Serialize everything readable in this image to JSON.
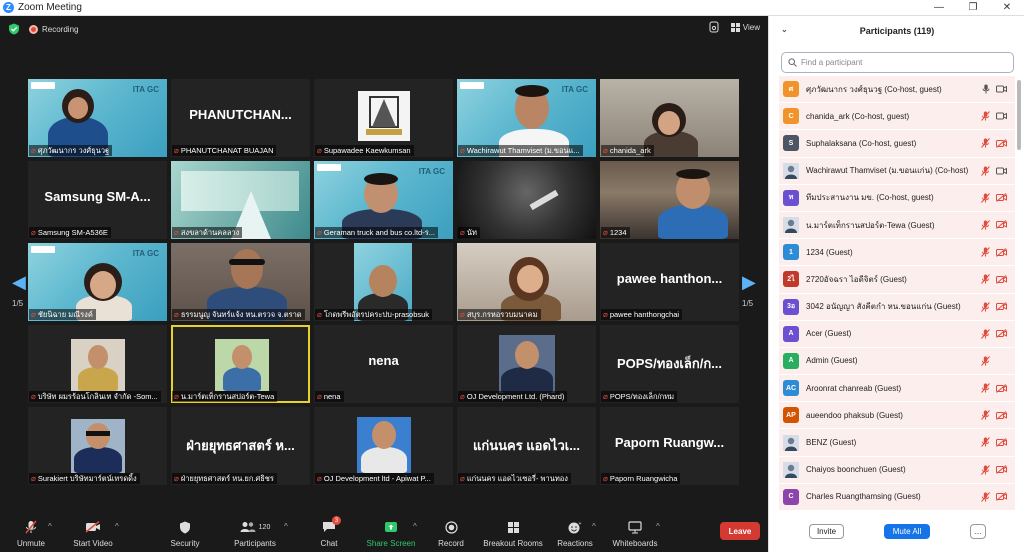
{
  "window": {
    "title": "Zoom Meeting",
    "minimize": "—",
    "maximize": "❐",
    "close": "✕"
  },
  "meeting": {
    "recording_label": "Recording",
    "view_label": "View",
    "page_left": "1/5",
    "page_right": "1/5",
    "tiles": [
      {
        "name": "ศุภวัฒนากร วงศ์ธุนวฐ",
        "big": "",
        "kind": "banner"
      },
      {
        "name": "PHANUTCHANAT BUAJAN",
        "big": "PHANUTCHAN...",
        "kind": "text"
      },
      {
        "name": "Supawadee Kaewkumsan",
        "big": "",
        "kind": "logo"
      },
      {
        "name": "Wachirawut Thamviset (ม.ขอนแ...",
        "big": "",
        "kind": "banner"
      },
      {
        "name": "chanida_ark",
        "big": "",
        "kind": "room"
      },
      {
        "name": "Samsung SM-A536E",
        "big": "Samsung SM-A...",
        "kind": "text"
      },
      {
        "name": "สงขลาด้านคลลาง",
        "big": "",
        "kind": "city"
      },
      {
        "name": "Geraman truck and bus co.ltd-ร...",
        "big": "",
        "kind": "banner"
      },
      {
        "name": "นัท",
        "big": "",
        "kind": "dark"
      },
      {
        "name": "1234",
        "big": "",
        "kind": "room"
      },
      {
        "name": "ชัยนิฉาย มณีรงค์",
        "big": "",
        "kind": "banner"
      },
      {
        "name": "ธรรมนูญ จันทร์แจ้ง หน.ตรวจ จ.ตราด",
        "big": "",
        "kind": "room"
      },
      {
        "name": "โกดพรีพอัตรปคระปบ-prasobsuk",
        "big": "",
        "kind": "banner"
      },
      {
        "name": "สบุร.กรหอรวบมนาคม",
        "big": "",
        "kind": "room"
      },
      {
        "name": "pawee hanthongchai",
        "big": "pawee hanthon...",
        "kind": "text"
      },
      {
        "name": "บริษัท ผมรร้อนโกลินเท จำกัด -Som...",
        "big": "",
        "kind": "photo"
      },
      {
        "name": "น.มาร์ตเท็กรานสปอร์ต-Tewa",
        "big": "",
        "kind": "photo"
      },
      {
        "name": "nena",
        "big": "nena",
        "kind": "text"
      },
      {
        "name": "OJ Development Ltd. (Phard)",
        "big": "",
        "kind": "photo"
      },
      {
        "name": "POPS/ทองเล็ก/กทม",
        "big": "POPS/ทองเล็ก/ก...",
        "kind": "text"
      },
      {
        "name": "Surakiert บริษัทมาร์ตน์เทรดดิ้ง",
        "big": "",
        "kind": "photo"
      },
      {
        "name": "ฝ่ายยุทธศาสตร์ หน.ยก.ศธิชร",
        "big": "ฝ่ายยุทธศาสตร์ ห...",
        "kind": "text"
      },
      {
        "name": "OJ Development ltd - Apiwat P...",
        "big": "",
        "kind": "photo"
      },
      {
        "name": "แก่นนคร แอดไวเซอรี่- พานทอง",
        "big": "แก่นนคร แอดไวเ...",
        "kind": "text"
      },
      {
        "name": "Paporn Ruangwicha",
        "big": "Paporn Ruangw...",
        "kind": "text"
      }
    ]
  },
  "toolbar": {
    "unmute": "Unmute",
    "start_video": "Start Video",
    "security": "Security",
    "participants": "Participants",
    "participants_count": "120",
    "chat": "Chat",
    "chat_badge": "3",
    "share_screen": "Share Screen",
    "record": "Record",
    "breakout": "Breakout Rooms",
    "reactions": "Reactions",
    "whiteboards": "Whiteboards",
    "leave": "Leave"
  },
  "panel": {
    "title": "Participants (119)",
    "search_placeholder": "Find a participant",
    "invite": "Invite",
    "mute_all": "Mute All",
    "more": "...",
    "participants": [
      {
        "initial": "ศ",
        "color": "#f0932b",
        "name": "ศุภวัฒนากร วงศ์ธุนวฐ (Co-host, guest)",
        "mic": "on",
        "cam": "on"
      },
      {
        "initial": "C",
        "color": "#f0932b",
        "name": "chanida_ark (Co-host, guest)",
        "mic": "off",
        "cam": "on"
      },
      {
        "initial": "S",
        "color": "#4b5563",
        "name": "Suphalaksana (Co-host, guest)",
        "mic": "off",
        "cam": "off"
      },
      {
        "initial": "",
        "color": "#9aa0a6",
        "name": "Wachirawut Thamviset (ม.ขอนแก่น) (Co-host)",
        "mic": "off",
        "cam": "on"
      },
      {
        "initial": "ท",
        "color": "#6b4fd1",
        "name": "ทีมประสานงาน มข. (Co-host, guest)",
        "mic": "off",
        "cam": "off"
      },
      {
        "initial": "",
        "color": "#9aa0a6",
        "name": "น.มาร์ตเท็กรานสปอร์ต-Tewa (Guest)",
        "mic": "off",
        "cam": "off"
      },
      {
        "initial": "1",
        "color": "#2d8cd6",
        "name": "1234 (Guest)",
        "mic": "off",
        "cam": "off"
      },
      {
        "initial": "2ไ",
        "color": "#c0392b",
        "name": "2720อัจฉรา ไอดีจิตร์ (Guest)",
        "mic": "off",
        "cam": "off"
      },
      {
        "initial": "3อ",
        "color": "#6b4fd1",
        "name": "3042 อนัญญา สังคีตกำ หน.ขอนแก่น (Guest)",
        "mic": "off",
        "cam": "off"
      },
      {
        "initial": "A",
        "color": "#6b4fd1",
        "name": "Acer (Guest)",
        "mic": "off",
        "cam": "off"
      },
      {
        "initial": "A",
        "color": "#27ae60",
        "name": "Admin (Guest)",
        "mic": "off",
        "cam": ""
      },
      {
        "initial": "AC",
        "color": "#2d8cd6",
        "name": "Aroonrat chanreab (Guest)",
        "mic": "off",
        "cam": "off"
      },
      {
        "initial": "AP",
        "color": "#d35400",
        "name": "aueendoo phaksub (Guest)",
        "mic": "off",
        "cam": "off"
      },
      {
        "initial": "",
        "color": "#9aa0a6",
        "name": "BENZ (Guest)",
        "mic": "off",
        "cam": "off"
      },
      {
        "initial": "",
        "color": "#9aa0a6",
        "name": "Chaiyos boonchuen (Guest)",
        "mic": "off",
        "cam": "off"
      },
      {
        "initial": "C",
        "color": "#8e44ad",
        "name": "Charles Ruangthamsing (Guest)",
        "mic": "off",
        "cam": "off"
      }
    ]
  }
}
